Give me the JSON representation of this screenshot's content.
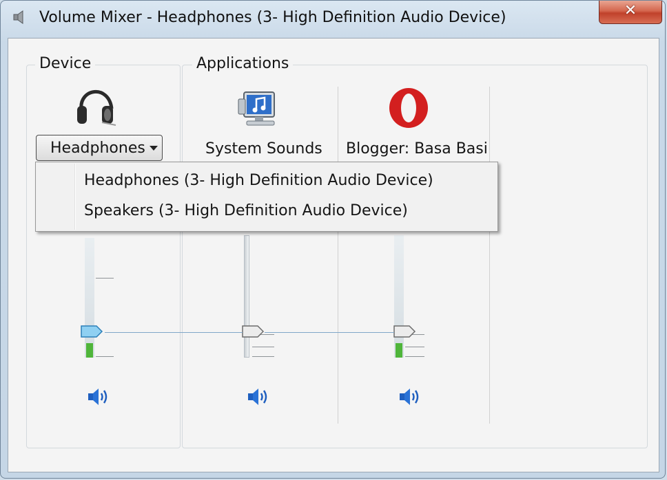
{
  "window": {
    "title": "Volume Mixer - Headphones (3- High Definition Audio Device)",
    "close_label": "✕",
    "app_icon": "speaker-icon"
  },
  "device": {
    "group_label": "Device",
    "icon": "headphones-icon",
    "selector_value": "Headphones",
    "volume_fraction": 0.22,
    "level_fraction": 0.12
  },
  "applications": {
    "group_label": "Applications",
    "items": [
      {
        "label": "System Sounds",
        "icon": "system-sounds-icon",
        "volume_fraction": 0.22,
        "level_fraction": 0.12
      },
      {
        "label": "Blogger: Basa Basi",
        "icon": "opera-icon",
        "volume_fraction": 0.22,
        "level_fraction": 0.12
      }
    ]
  },
  "dropdown": {
    "options": [
      "Headphones (3- High Definition Audio Device)",
      "Speakers (3- High Definition Audio Device)"
    ]
  },
  "colors": {
    "thumb_active": "#3fa7e3",
    "level_green": "#4fb53a",
    "speaker_blue": "#1f5fbf",
    "close_red": "#c9452f",
    "opera_red": "#d31f1f"
  }
}
